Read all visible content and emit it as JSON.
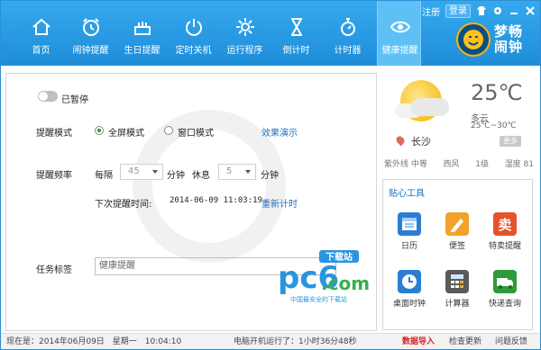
{
  "top_links": {
    "register": "注册",
    "login": "登录"
  },
  "tabs": [
    {
      "label": "首页",
      "icon": "home-icon"
    },
    {
      "label": "闹钟提醒",
      "icon": "alarm-clock-icon"
    },
    {
      "label": "生日提醒",
      "icon": "birthday-cake-icon"
    },
    {
      "label": "定时关机",
      "icon": "power-icon"
    },
    {
      "label": "运行程序",
      "icon": "gear-icon"
    },
    {
      "label": "倒计时",
      "icon": "hourglass-icon"
    },
    {
      "label": "计时器",
      "icon": "stopwatch-icon"
    },
    {
      "label": "健康提醒",
      "icon": "eye-icon",
      "active": true
    }
  ],
  "brand": {
    "name_line1": "梦畅",
    "name_line2": "闹钟"
  },
  "main": {
    "pause_label": "已暂停",
    "mode_label": "提醒模式",
    "mode_fullscreen": "全屏模式",
    "mode_window": "窗口模式",
    "demo_link": "效果演示",
    "freq_label": "提醒频率",
    "every_label": "每隔",
    "every_value": "45",
    "minute_label": "分钟",
    "rest_label": "休息",
    "rest_value": "5",
    "minute_label2": "分钟",
    "next_label": "下次提醒时间:",
    "next_time": "2014-06-09 11:03:19",
    "reset_link": "重新计时",
    "tag_label": "任务标签",
    "tag_value": "健康提醒"
  },
  "watermark": {
    "pc6": "pc6",
    "com": ".com",
    "badge": "下载站",
    "slogan": "中国最安全的下载站"
  },
  "weather": {
    "temp": "25℃",
    "condition": "多云",
    "range": "25℃~30℃",
    "more": "更多",
    "city": "长沙",
    "uv": "紫外线 中等",
    "wind_dir": "西风",
    "wind_level": "1级",
    "humidity": "湿度 81"
  },
  "tools": {
    "title": "贴心工具",
    "items": [
      {
        "label": "日历",
        "icon": "calendar-icon",
        "color": "#2a7fd4"
      },
      {
        "label": "便签",
        "icon": "notepad-icon",
        "color": "#f2a22a"
      },
      {
        "label": "特卖提醒",
        "icon": "sale-icon",
        "color": "#e5532a"
      },
      {
        "label": "桌面时钟",
        "icon": "desktop-clock-icon",
        "color": "#2a7fd4"
      },
      {
        "label": "计算器",
        "icon": "calculator-icon",
        "color": "#5a5a5a"
      },
      {
        "label": "快递查询",
        "icon": "express-icon",
        "color": "#2e9a3a"
      }
    ]
  },
  "status": {
    "now": "现在是：2014年06月09日　星期一　10:04:10",
    "uptime": "电脑开机运行了：1小时36分48秒",
    "import": "数据导入",
    "update": "检查更新",
    "feedback": "问题反馈"
  },
  "colors": {
    "header": "#1e8dd9",
    "active_tab": "#5fc0f5",
    "link": "#1a6fc2",
    "import": "#d42020"
  }
}
